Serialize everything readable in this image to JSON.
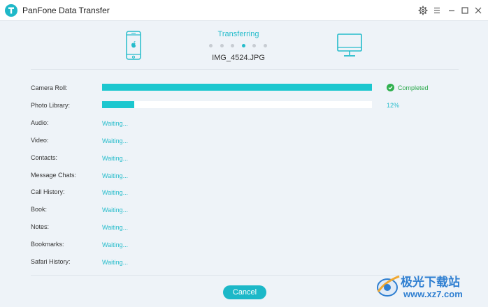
{
  "app": {
    "title": "PanFone Data Transfer"
  },
  "transfer": {
    "status": "Transferring",
    "filename": "IMG_4524.JPG",
    "dots_total": 6,
    "dots_active_index": 3
  },
  "items": [
    {
      "label": "Camera Roll:",
      "state": "progress",
      "progress": 1.0,
      "status_text": "Completed"
    },
    {
      "label": "Photo Library:",
      "state": "progress",
      "progress": 0.12,
      "status_text": "12%"
    },
    {
      "label": "Audio:",
      "state": "waiting",
      "status_text": "Waiting..."
    },
    {
      "label": "Video:",
      "state": "waiting",
      "status_text": "Waiting..."
    },
    {
      "label": "Contacts:",
      "state": "waiting",
      "status_text": "Waiting..."
    },
    {
      "label": "Message Chats:",
      "state": "waiting",
      "status_text": "Waiting..."
    },
    {
      "label": "Call History:",
      "state": "waiting",
      "status_text": "Waiting..."
    },
    {
      "label": "Book:",
      "state": "waiting",
      "status_text": "Waiting..."
    },
    {
      "label": "Notes:",
      "state": "waiting",
      "status_text": "Waiting..."
    },
    {
      "label": "Bookmarks:",
      "state": "waiting",
      "status_text": "Waiting..."
    },
    {
      "label": "Safari History:",
      "state": "waiting",
      "status_text": "Waiting..."
    }
  ],
  "actions": {
    "cancel_label": "Cancel"
  },
  "watermark": {
    "text_cn": "极光下载站",
    "url": "www.xz7.com"
  },
  "icons": {
    "app_logo": "panfone-logo-icon",
    "settings": "gear-icon",
    "menu": "menu-icon",
    "minimize": "minimize-icon",
    "maximize": "maximize-icon",
    "close": "close-icon",
    "source_device": "iphone-icon",
    "target_device": "monitor-icon",
    "completed": "check-circle-icon"
  },
  "colors": {
    "accent": "#1cb8c8",
    "success": "#2fb04e",
    "background": "#eef3f8"
  }
}
